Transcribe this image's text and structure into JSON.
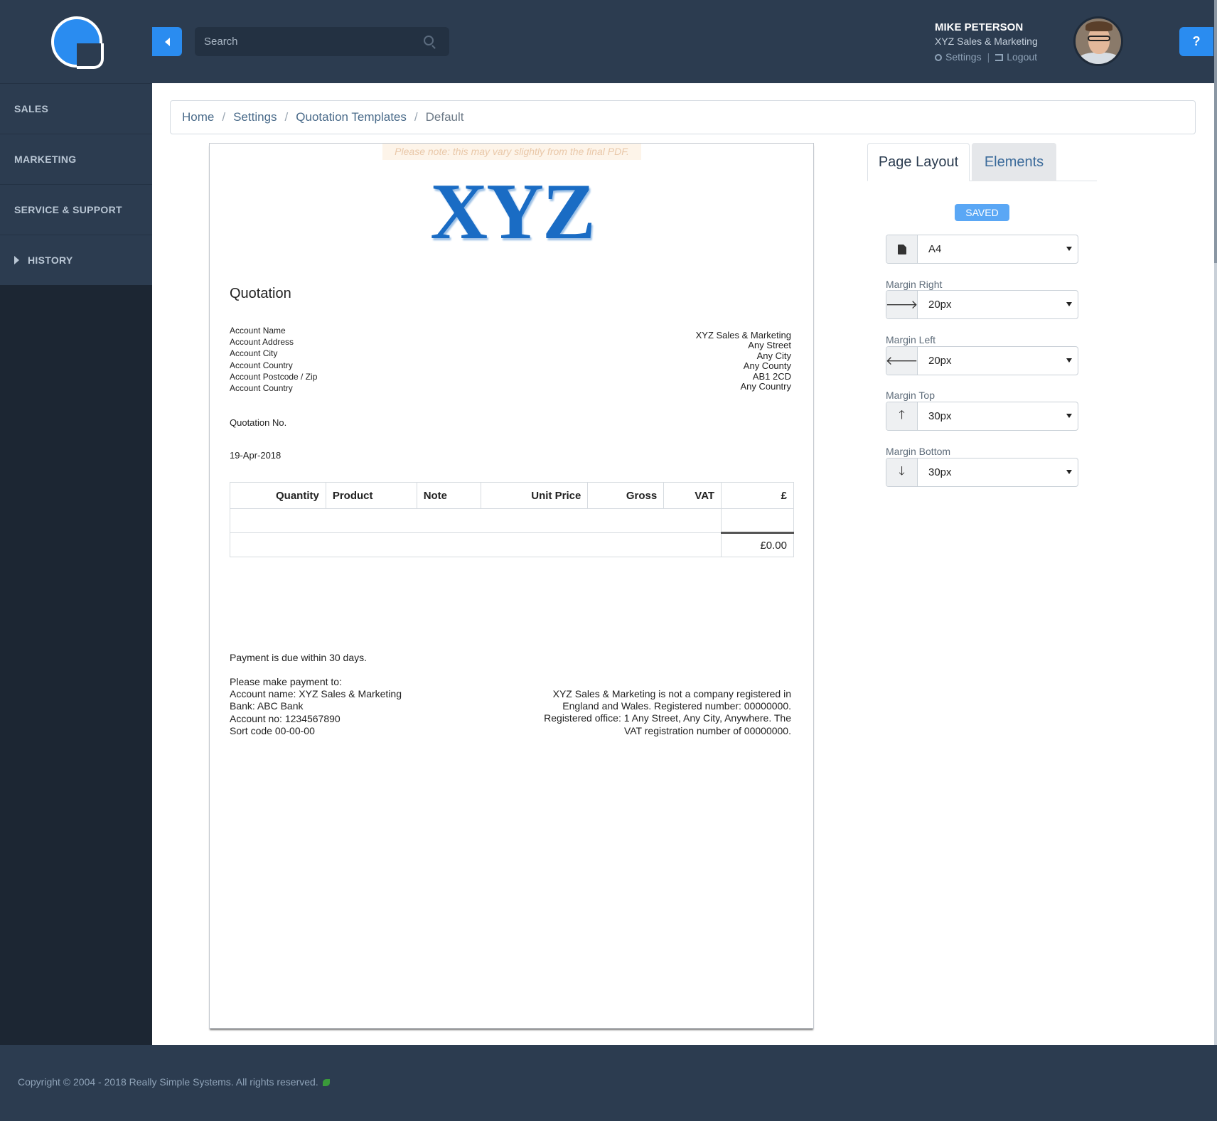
{
  "sidebar": {
    "items": [
      {
        "label": "SALES"
      },
      {
        "label": "MARKETING"
      },
      {
        "label": "SERVICE & SUPPORT"
      },
      {
        "label": "HISTORY"
      }
    ]
  },
  "header": {
    "search_placeholder": "Search",
    "user_name": "MIKE PETERSON",
    "company": "XYZ Sales & Marketing",
    "settings_label": "Settings",
    "separator": "|",
    "logout_label": "Logout",
    "help_label": "?"
  },
  "breadcrumb": {
    "items": [
      "Home",
      "Settings",
      "Quotation Templates"
    ],
    "current": "Default"
  },
  "document": {
    "note": "Please note: this may vary slightly from the final PDF.",
    "logo_text": "XYZ",
    "title": "Quotation",
    "account_labels": [
      "Account Name",
      "Account Address",
      "Account City",
      "Account Country",
      "Account Postcode / Zip",
      "Account Country"
    ],
    "company_address": [
      "XYZ Sales & Marketing",
      "Any Street",
      "Any City",
      "Any County",
      "AB1 2CD",
      "Any Country"
    ],
    "quotation_no_label": "Quotation No.",
    "date": "19-Apr-2018",
    "table": {
      "columns": [
        "Quantity",
        "Product",
        "Note",
        "Unit Price",
        "Gross",
        "VAT",
        "£"
      ],
      "total": "£0.00"
    },
    "payment_terms": "Payment is due within 30 days.",
    "payment_details": [
      "Please make payment to:",
      "Account name: XYZ Sales & Marketing",
      "Bank: ABC Bank",
      "Account no: 1234567890",
      "Sort code 00-00-00"
    ],
    "company_legal": [
      "XYZ Sales & Marketing is not a company registered in",
      "England and Wales. Registered number: 00000000.",
      "Registered office: 1 Any Street, Any City, Anywhere. The",
      "VAT registration number of 00000000."
    ]
  },
  "panel": {
    "tabs": [
      {
        "label": "Page Layout",
        "active": true
      },
      {
        "label": "Elements",
        "active": false
      }
    ],
    "saved_label": "SAVED",
    "page_size": "A4",
    "fields": [
      {
        "label": "Margin Right",
        "value": "20px",
        "icon": "arrow-right-icon"
      },
      {
        "label": "Margin Left",
        "value": "20px",
        "icon": "arrow-left-icon"
      },
      {
        "label": "Margin Top",
        "value": "30px",
        "icon": "arrow-up-icon"
      },
      {
        "label": "Margin Bottom",
        "value": "30px",
        "icon": "arrow-down-icon"
      }
    ]
  },
  "footer": {
    "copyright": "Copyright © 2004 - 2018 Really Simple Systems. All rights reserved."
  },
  "colors": {
    "sidebar_bg": "#1c2633",
    "header_bg": "#2c3c50",
    "accent": "#2a8cf0",
    "logo_blue": "#1a6cc4"
  }
}
